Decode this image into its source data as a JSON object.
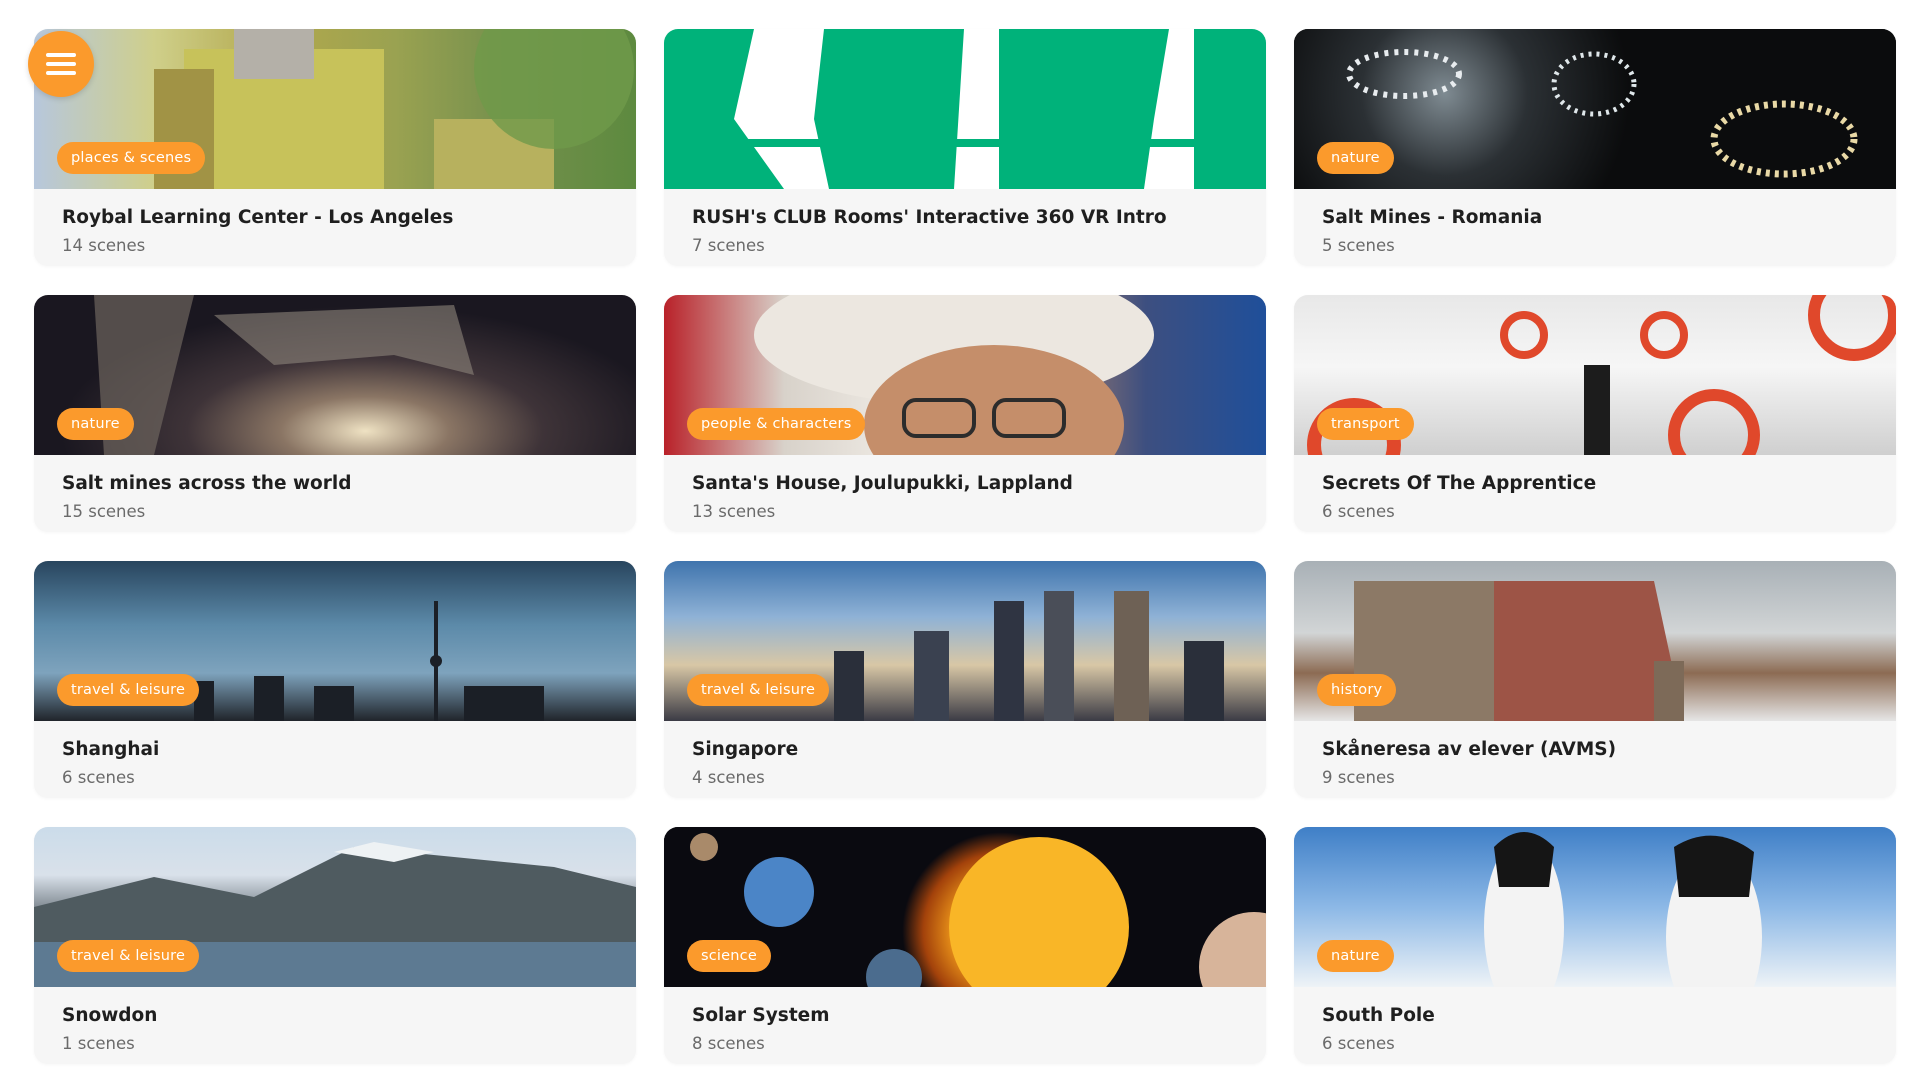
{
  "menu_button": {
    "icon": "hamburger-menu-icon",
    "color": "#fb9a2c"
  },
  "accent_color": "#fb9a2c",
  "tours": [
    {
      "title": "Roybal Learning Center - Los Angeles",
      "scenes": "14 scenes",
      "category": "places & scenes"
    },
    {
      "title": "RUSH's CLUB Rooms' Interactive 360 VR Intro",
      "scenes": "7 scenes",
      "category": ""
    },
    {
      "title": "Salt Mines - Romania",
      "scenes": "5 scenes",
      "category": "nature"
    },
    {
      "title": "Salt mines across the world",
      "scenes": "15 scenes",
      "category": "nature"
    },
    {
      "title": "Santa's House, Joulupukki, Lappland",
      "scenes": "13 scenes",
      "category": "people & characters"
    },
    {
      "title": "Secrets Of The Apprentice",
      "scenes": "6 scenes",
      "category": "transport"
    },
    {
      "title": "Shanghai",
      "scenes": "6 scenes",
      "category": "travel & leisure"
    },
    {
      "title": "Singapore",
      "scenes": "4 scenes",
      "category": "travel & leisure"
    },
    {
      "title": "Skåneresa av elever (AVMS)",
      "scenes": "9 scenes",
      "category": "history"
    },
    {
      "title": "Snowdon",
      "scenes": "1 scenes",
      "category": "travel & leisure"
    },
    {
      "title": "Solar System",
      "scenes": "8 scenes",
      "category": "science"
    },
    {
      "title": "South Pole",
      "scenes": "6 scenes",
      "category": "nature"
    }
  ]
}
